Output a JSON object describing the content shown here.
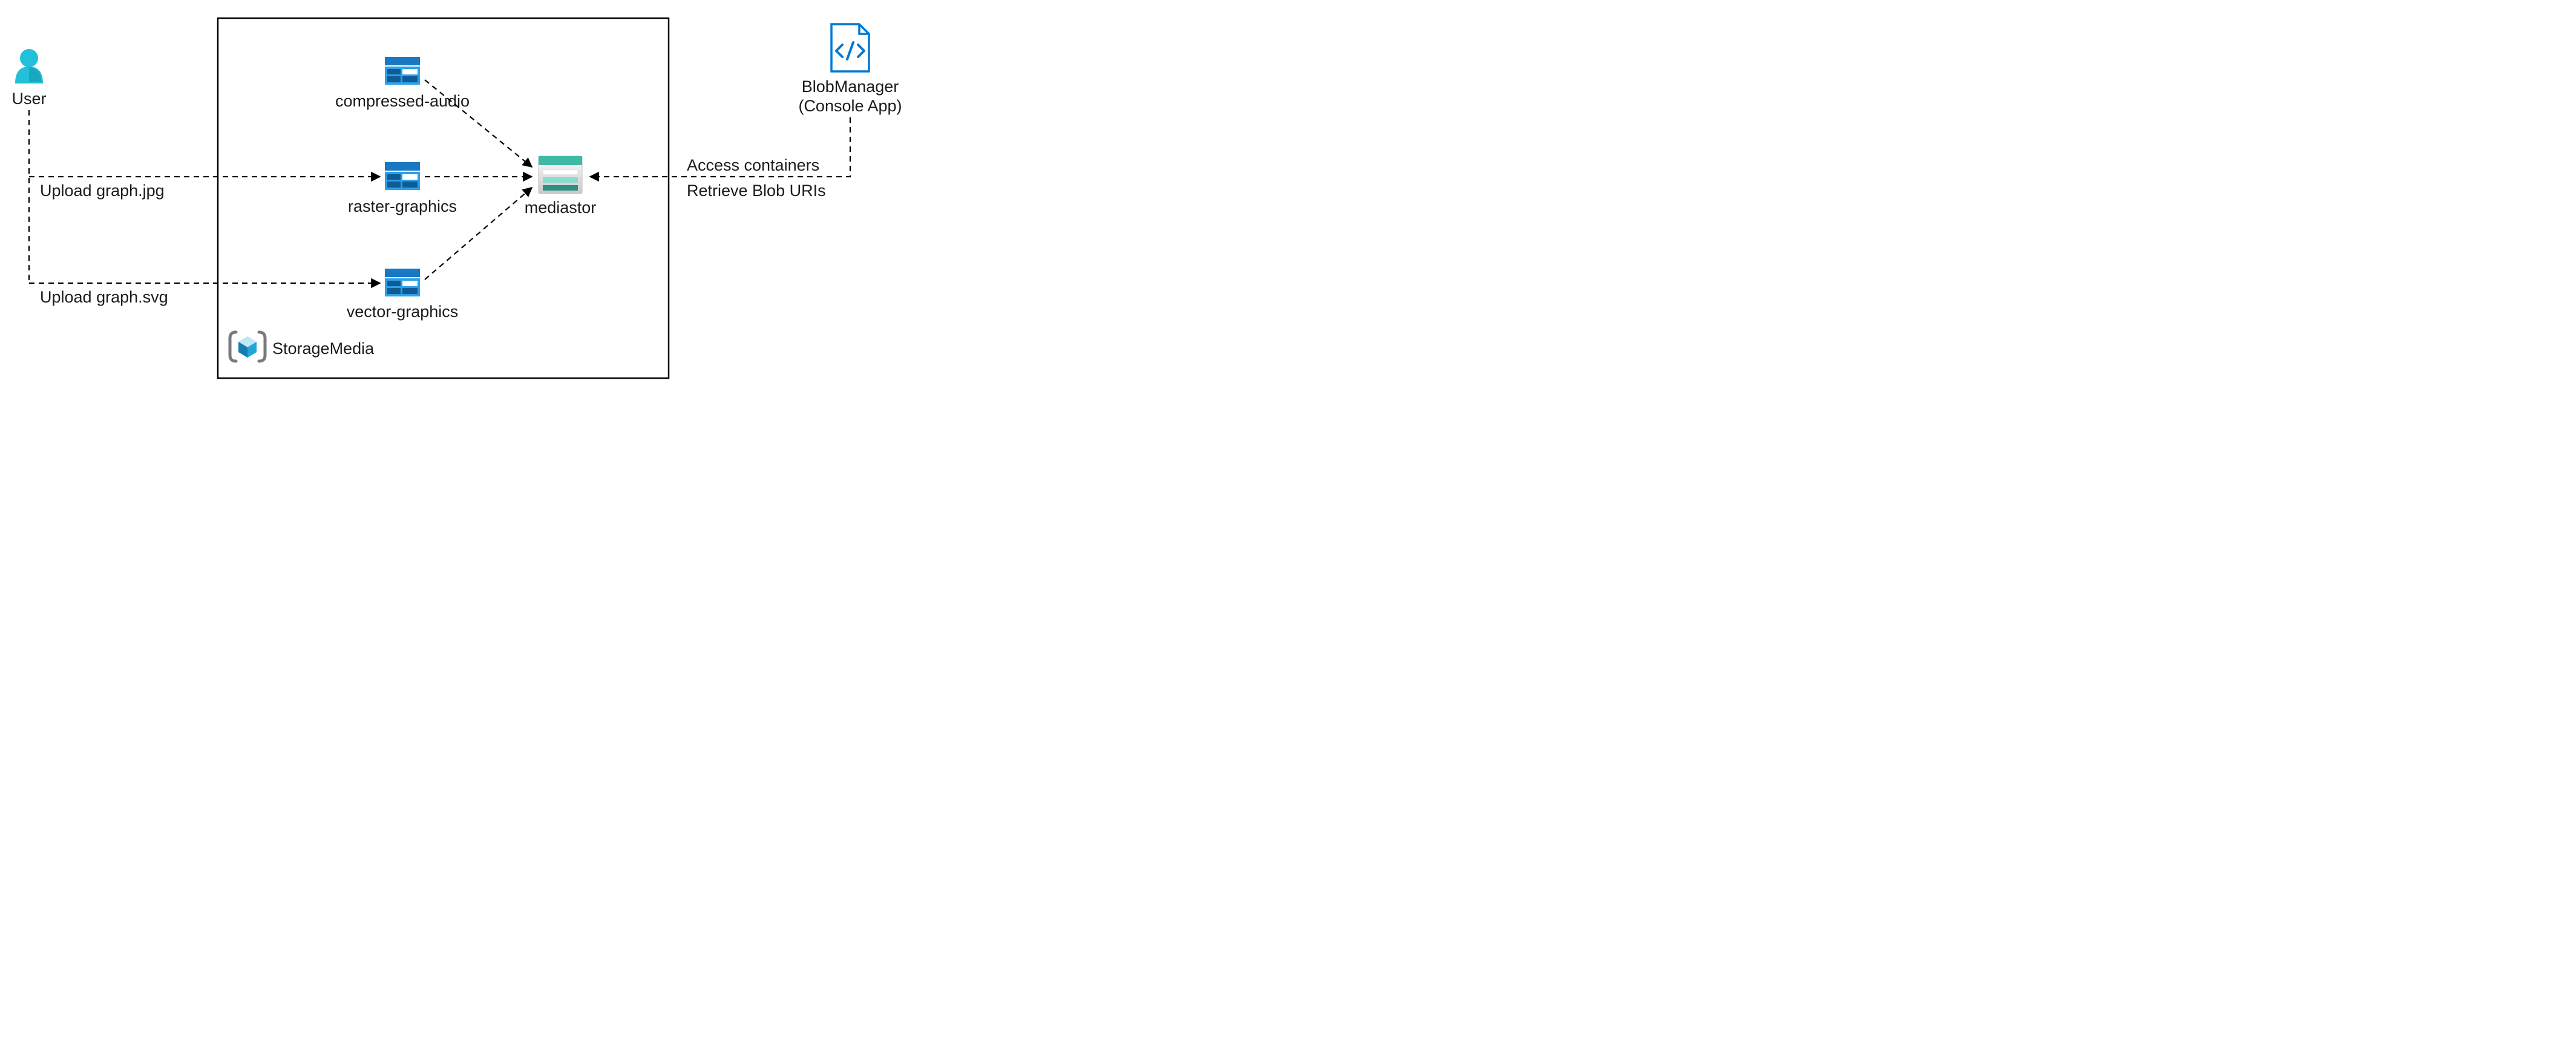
{
  "user": {
    "label": "User"
  },
  "actions": {
    "upload_jpg": "Upload graph.jpg",
    "upload_svg": "Upload graph.svg"
  },
  "resourceGroup": {
    "label": "StorageMedia"
  },
  "containers": {
    "compressed_audio": "compressed-audio",
    "raster_graphics": "raster-graphics",
    "vector_graphics": "vector-graphics"
  },
  "storageAccount": {
    "label": "mediastor"
  },
  "app": {
    "line1": "BlobManager",
    "line2": "(Console App)"
  },
  "appActions": {
    "access": "Access containers",
    "retrieve": "Retrieve Blob URIs"
  },
  "colors": {
    "userFill": "#22c1da",
    "azureBlue": "#0078d4",
    "containerDark": "#1a77c2",
    "containerLight": "#2aa1e8",
    "tealHeader": "#3fb8a5",
    "tealLight": "#8adccf",
    "tealDark": "#2e8f82",
    "bracketGray": "#7a7a7a",
    "cubeLight": "#6bd0ee",
    "cubeMid": "#1fa7da",
    "cubeDark": "#167bb0"
  }
}
